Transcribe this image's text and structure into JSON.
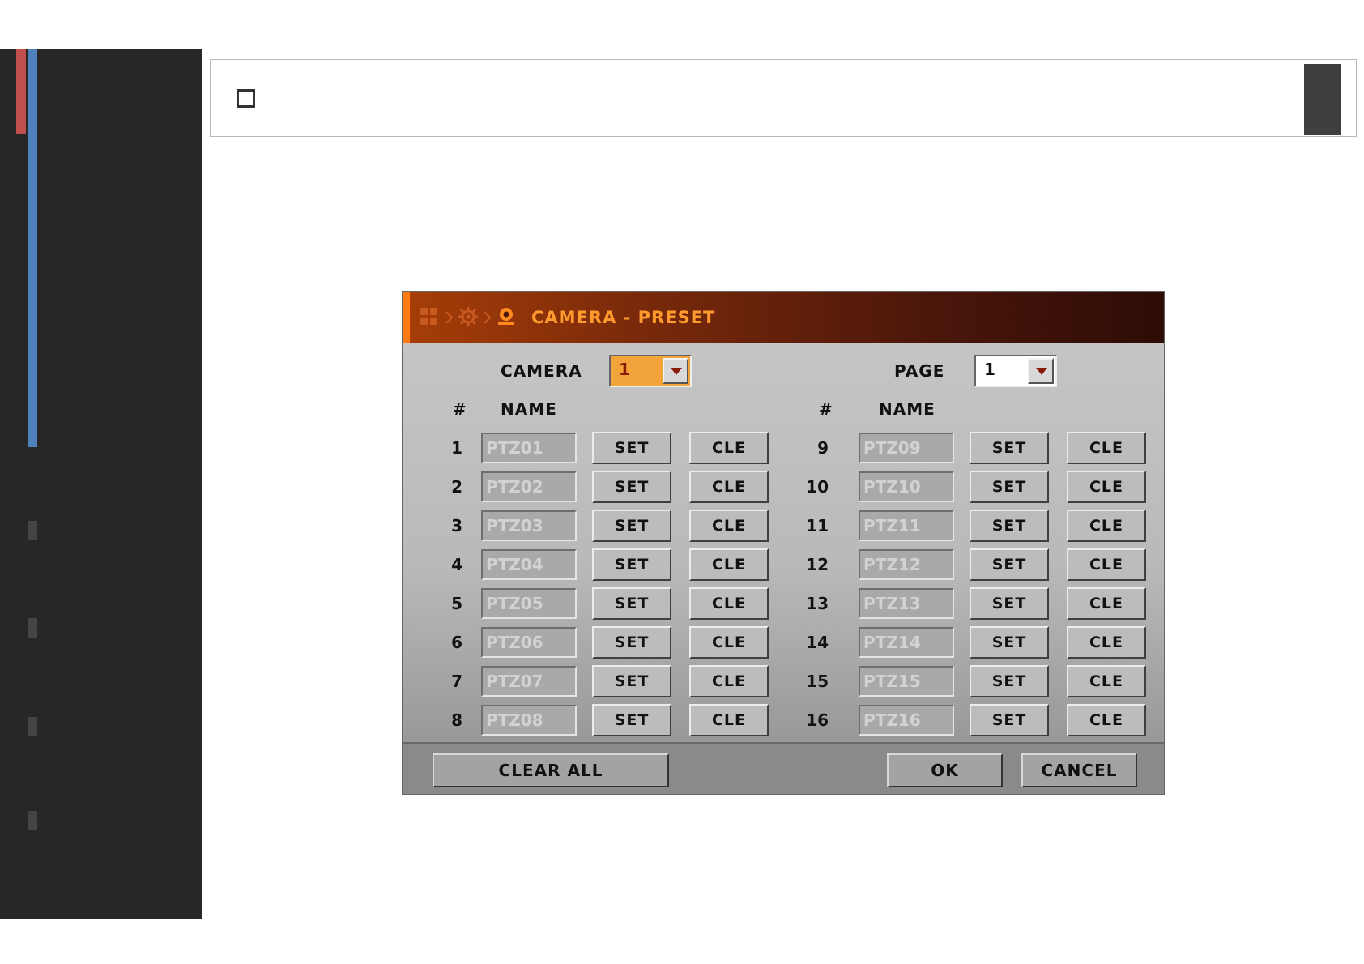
{
  "dialog": {
    "title": "CAMERA - PRESET",
    "camera_label": "CAMERA",
    "camera_value": "1",
    "page_label": "PAGE",
    "page_value": "1",
    "col_hash": "#",
    "col_name": "NAME",
    "left_rows": [
      {
        "num": "1",
        "name": "PTZ01",
        "set": "SET",
        "cle": "CLE"
      },
      {
        "num": "2",
        "name": "PTZ02",
        "set": "SET",
        "cle": "CLE"
      },
      {
        "num": "3",
        "name": "PTZ03",
        "set": "SET",
        "cle": "CLE"
      },
      {
        "num": "4",
        "name": "PTZ04",
        "set": "SET",
        "cle": "CLE"
      },
      {
        "num": "5",
        "name": "PTZ05",
        "set": "SET",
        "cle": "CLE"
      },
      {
        "num": "6",
        "name": "PTZ06",
        "set": "SET",
        "cle": "CLE"
      },
      {
        "num": "7",
        "name": "PTZ07",
        "set": "SET",
        "cle": "CLE"
      },
      {
        "num": "8",
        "name": "PTZ08",
        "set": "SET",
        "cle": "CLE"
      }
    ],
    "right_rows": [
      {
        "num": "9",
        "name": "PTZ09",
        "set": "SET",
        "cle": "CLE"
      },
      {
        "num": "10",
        "name": "PTZ10",
        "set": "SET",
        "cle": "CLE"
      },
      {
        "num": "11",
        "name": "PTZ11",
        "set": "SET",
        "cle": "CLE"
      },
      {
        "num": "12",
        "name": "PTZ12",
        "set": "SET",
        "cle": "CLE"
      },
      {
        "num": "13",
        "name": "PTZ13",
        "set": "SET",
        "cle": "CLE"
      },
      {
        "num": "14",
        "name": "PTZ14",
        "set": "SET",
        "cle": "CLE"
      },
      {
        "num": "15",
        "name": "PTZ15",
        "set": "SET",
        "cle": "CLE"
      },
      {
        "num": "16",
        "name": "PTZ16",
        "set": "SET",
        "cle": "CLE"
      }
    ],
    "clear_all_label": "CLEAR ALL",
    "ok_label": "OK",
    "cancel_label": "CANCEL"
  },
  "icons": {
    "breadcrumb": [
      "grid-icon",
      "chevron-right-icon",
      "gear-icon",
      "chevron-right-icon",
      "camera-icon"
    ]
  },
  "colors": {
    "title_text": "#ff9a2e",
    "camera_combo": "#f2a33a",
    "sidebar": "#272727",
    "accent_red": "#c0504d",
    "accent_blue": "#4f81bd"
  }
}
